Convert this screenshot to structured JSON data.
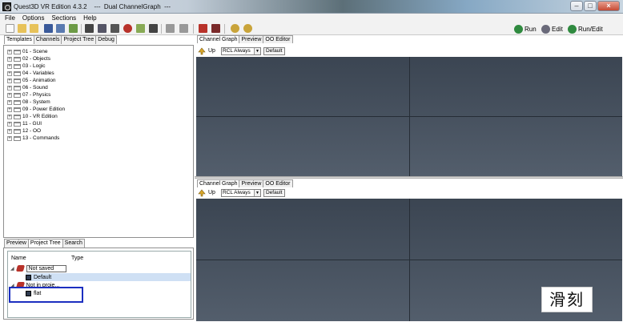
{
  "window": {
    "title": "Quest3D VR Edition 4.3.2    ---  Dual ChannelGraph  ---"
  },
  "menu": [
    "File",
    "Options",
    "Sections",
    "Help"
  ],
  "toolbar": {
    "run": "Run",
    "edit": "Edit",
    "run_edit": "Run/Edit"
  },
  "left_tabs": [
    "Templates",
    "Channels",
    "Project Tree",
    "Debug"
  ],
  "templates": [
    "01 - Scene",
    "02 - Objects",
    "03 - Logic",
    "04 - Variables",
    "05 - Animation",
    "06 - Sound",
    "07 - Physics",
    "08 - System",
    "09 - Power Edition",
    "10 - VR Edition",
    "11 - GUI",
    "12 - OO",
    "13 - Commands"
  ],
  "lower_tabs": [
    "Preview",
    "Project Tree",
    "Search"
  ],
  "project_tree": {
    "col_name": "Name",
    "col_type": "Type",
    "rows": [
      "Not saved",
      "Default",
      "Not in proje...",
      "flat"
    ]
  },
  "graph_panes": [
    {
      "tabs": [
        "Channel Graph",
        "Preview",
        "OO Editor"
      ],
      "up": "Up",
      "dropdown": "RCL Always",
      "default_btn": "Default"
    },
    {
      "tabs": [
        "Channel Graph",
        "Preview",
        "OO Editor"
      ],
      "up": "Up",
      "dropdown": "RCL Always",
      "default_btn": "Default"
    }
  ],
  "colors": {
    "graph_bg": "#455060",
    "selection": "#1c2fc0",
    "accent_red": "#b8322a"
  },
  "icons": [
    "app-icon",
    "new-icon",
    "open-icon",
    "save-icon",
    "run-icon",
    "edit-icon",
    "run-edit-icon",
    "up-arrow-icon",
    "folder-icon"
  ]
}
